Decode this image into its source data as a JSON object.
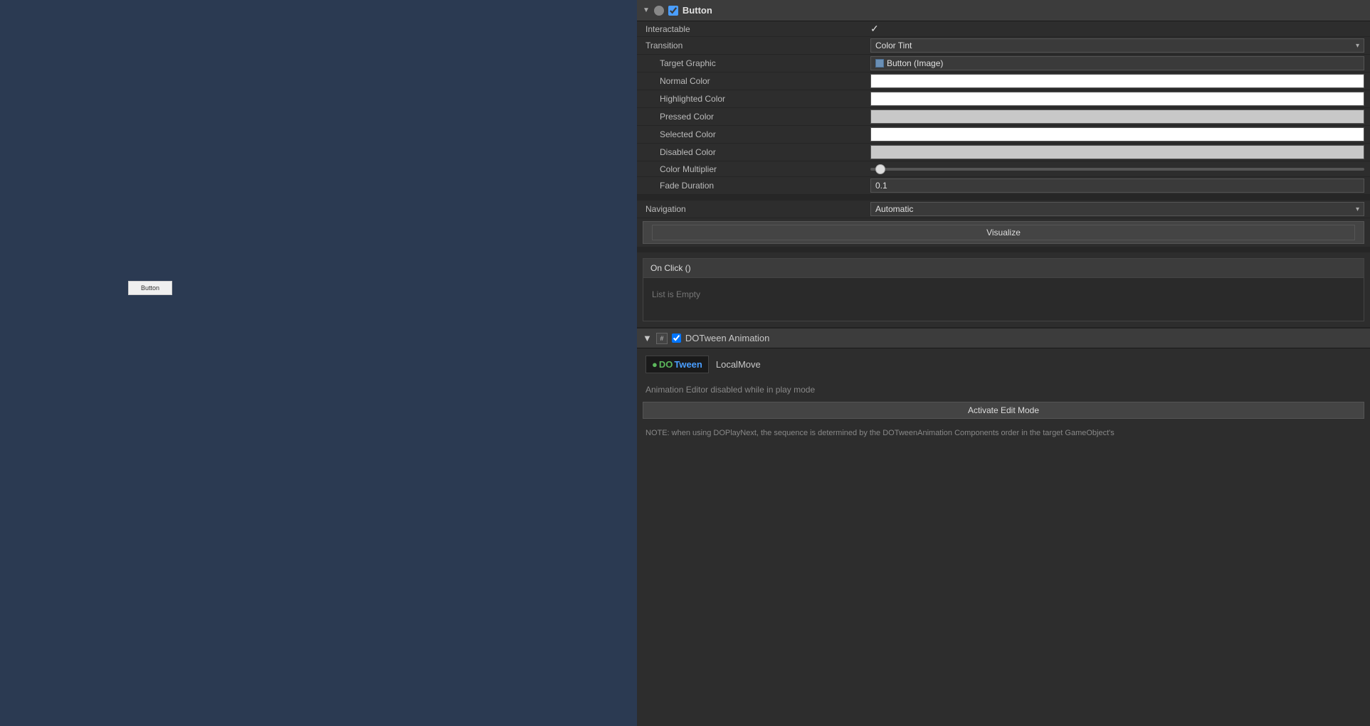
{
  "sceneView": {
    "buttonLabel": "Button"
  },
  "inspector": {
    "button": {
      "componentName": "Button",
      "enabled": true,
      "interactable": {
        "label": "Interactable",
        "value": true
      },
      "transition": {
        "label": "Transition",
        "value": "Color Tint"
      },
      "targetGraphic": {
        "label": "Target Graphic",
        "value": "Button (Image)"
      },
      "normalColor": {
        "label": "Normal Color"
      },
      "highlightedColor": {
        "label": "Highlighted Color"
      },
      "pressedColor": {
        "label": "Pressed Color"
      },
      "selectedColor": {
        "label": "Selected Color"
      },
      "disabledColor": {
        "label": "Disabled Color"
      },
      "colorMultiplier": {
        "label": "Color Multiplier",
        "value": 1
      },
      "fadeDuration": {
        "label": "Fade Duration",
        "value": "0.1"
      },
      "navigation": {
        "label": "Navigation",
        "value": "Automatic"
      },
      "visualizeBtn": "Visualize",
      "onClickHeader": "On Click ()",
      "onClickEmpty": "List is Empty"
    },
    "dotween": {
      "componentName": "DOTween Animation",
      "logoText": "DOTween",
      "localMove": "LocalMove",
      "animDisabledText": "Animation Editor disabled while in play mode",
      "activateBtn": "Activate Edit Mode",
      "noteText": "NOTE: when using DOPlayNext, the sequence is determined by the DOTweenAnimation Components order in the target GameObject's"
    }
  }
}
